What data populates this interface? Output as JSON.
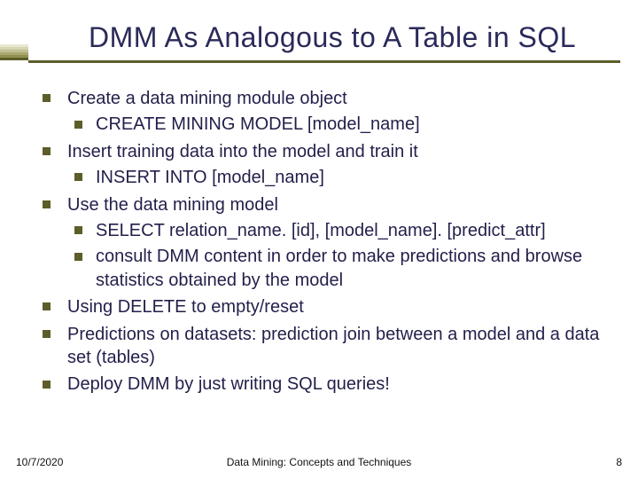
{
  "title": "DMM As Analogous to A Table in SQL",
  "bullets": {
    "b0": {
      "text": "Create a data mining module object"
    },
    "b0s0": {
      "text": "CREATE MINING MODEL [model_name]"
    },
    "b1": {
      "text": "Insert training data into the model and train it"
    },
    "b1s0": {
      "text": "INSERT INTO [model_name]"
    },
    "b2": {
      "text": "Use the data mining model"
    },
    "b2s0": {
      "text": "SELECT relation_name. [id], [model_name]. [predict_attr]"
    },
    "b2s1": {
      "text": "consult DMM content in order to make predictions and browse statistics obtained by the model"
    },
    "b3": {
      "text": "Using DELETE to empty/reset"
    },
    "b4": {
      "text": "Predictions on datasets: prediction join between a model and a data set (tables)"
    },
    "b5": {
      "text": "Deploy DMM by just writing SQL queries!"
    }
  },
  "footer": {
    "date": "10/7/2020",
    "center": "Data Mining: Concepts and Techniques",
    "page": "8"
  }
}
